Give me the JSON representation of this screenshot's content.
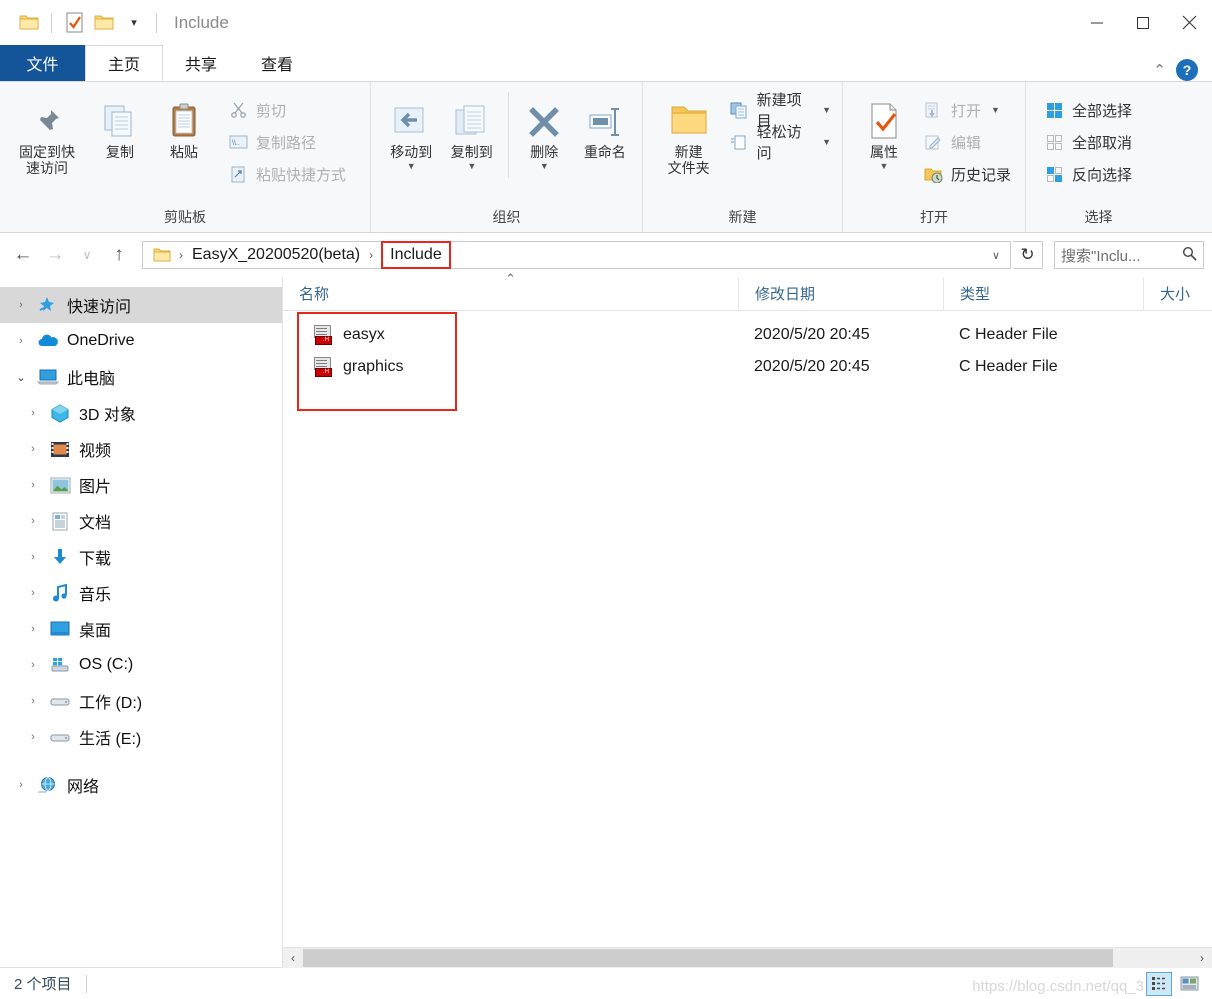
{
  "window": {
    "title": "Include",
    "minimize_label": "─",
    "maximize_label": "□",
    "close_label": "✕"
  },
  "quick_access": {
    "folder_icon": "folder-icon",
    "properties_icon": "properties-checkmark-icon",
    "new_folder_icon": "new-folder-icon",
    "customize_label": "▾"
  },
  "tabs": [
    {
      "label": "文件",
      "type": "file"
    },
    {
      "label": "主页",
      "type": "active"
    },
    {
      "label": "共享",
      "type": "normal"
    },
    {
      "label": "查看",
      "type": "normal"
    }
  ],
  "ribbon": {
    "collapse_label": "⌃",
    "help_label": "?",
    "groups": [
      {
        "name": "clipboard",
        "label": "剪贴板",
        "big_buttons": [
          {
            "name": "pin-to-quick-access",
            "line1": "固定到快",
            "line2": "速访问",
            "icon": "pin-icon"
          },
          {
            "name": "copy",
            "line1": "复制",
            "line2": "",
            "icon": "copy-icon"
          },
          {
            "name": "paste",
            "line1": "粘贴",
            "line2": "",
            "icon": "paste-clipboard-icon"
          }
        ],
        "small_buttons": [
          {
            "name": "cut",
            "label": "剪切",
            "icon": "scissors-icon"
          },
          {
            "name": "copy-path",
            "label": "复制路径",
            "icon": "copy-path-icon"
          },
          {
            "name": "paste-shortcut",
            "label": "粘贴快捷方式",
            "icon": "paste-shortcut-icon"
          }
        ]
      },
      {
        "name": "organize",
        "label": "组织",
        "big_buttons": [
          {
            "name": "move-to",
            "line1": "移动到",
            "line2": "",
            "icon": "move-to-icon",
            "caret": true
          },
          {
            "name": "copy-to",
            "line1": "复制到",
            "line2": "",
            "icon": "copy-to-icon",
            "caret": true
          },
          {
            "name": "delete",
            "line1": "删除",
            "line2": "",
            "icon": "delete-x-icon",
            "caret": true
          },
          {
            "name": "rename",
            "line1": "重命名",
            "line2": "",
            "icon": "rename-icon"
          }
        ]
      },
      {
        "name": "new",
        "label": "新建",
        "big_buttons": [
          {
            "name": "new-folder",
            "line1": "新建",
            "line2": "文件夹",
            "icon": "new-folder-icon"
          }
        ],
        "small_buttons": [
          {
            "name": "new-item",
            "label": "新建项目",
            "icon": "new-item-icon",
            "caret": true
          },
          {
            "name": "easy-access",
            "label": "轻松访问",
            "icon": "easy-access-icon",
            "caret": true
          }
        ]
      },
      {
        "name": "open",
        "label": "打开",
        "big_buttons": [
          {
            "name": "properties",
            "line1": "属性",
            "line2": "",
            "icon": "properties-checkmark-icon",
            "caret": true
          }
        ],
        "small_buttons": [
          {
            "name": "open",
            "label": "打开",
            "icon": "open-icon",
            "caret": true
          },
          {
            "name": "edit",
            "label": "编辑",
            "icon": "edit-pencil-icon"
          },
          {
            "name": "history",
            "label": "历史记录",
            "icon": "history-icon"
          }
        ]
      },
      {
        "name": "select",
        "label": "选择",
        "small_buttons": [
          {
            "name": "select-all",
            "label": "全部选择",
            "icon": "select-all-icon"
          },
          {
            "name": "select-none",
            "label": "全部取消",
            "icon": "select-none-icon"
          },
          {
            "name": "invert-selection",
            "label": "反向选择",
            "icon": "invert-selection-icon"
          }
        ]
      }
    ]
  },
  "address": {
    "back_label": "←",
    "forward_label": "→",
    "recent_label": "∨",
    "up_label": "↑",
    "folder_icon": "folder-icon",
    "crumbs": [
      {
        "label": "EasyX_20200520(beta)",
        "highlighted": false
      },
      {
        "label": "Include",
        "highlighted": true
      }
    ],
    "separator": "›",
    "dropdown_label": "∨",
    "refresh_label": "↻"
  },
  "search": {
    "text": "搜索\"Inclu...",
    "icon": "search-icon"
  },
  "nav_pane": {
    "items": [
      {
        "label": "快速访问",
        "icon": "quick-access-star-icon",
        "level": 0,
        "expanded": false,
        "selected": true
      },
      {
        "label": "OneDrive",
        "icon": "onedrive-cloud-icon",
        "level": 0,
        "expanded": false,
        "selected": false
      },
      {
        "label": "此电脑",
        "icon": "this-pc-icon",
        "level": 0,
        "expanded": true,
        "selected": false
      },
      {
        "label": "3D 对象",
        "icon": "3d-objects-icon",
        "level": 1,
        "expanded": false,
        "selected": false
      },
      {
        "label": "视频",
        "icon": "videos-icon",
        "level": 1,
        "expanded": false,
        "selected": false
      },
      {
        "label": "图片",
        "icon": "pictures-icon",
        "level": 1,
        "expanded": false,
        "selected": false
      },
      {
        "label": "文档",
        "icon": "documents-icon",
        "level": 1,
        "expanded": false,
        "selected": false
      },
      {
        "label": "下载",
        "icon": "downloads-icon",
        "level": 1,
        "expanded": false,
        "selected": false
      },
      {
        "label": "音乐",
        "icon": "music-icon",
        "level": 1,
        "expanded": false,
        "selected": false
      },
      {
        "label": "桌面",
        "icon": "desktop-icon",
        "level": 1,
        "expanded": false,
        "selected": false
      },
      {
        "label": "OS (C:)",
        "icon": "os-drive-icon",
        "level": 1,
        "expanded": false,
        "selected": false
      },
      {
        "label": "工作 (D:)",
        "icon": "drive-icon",
        "level": 1,
        "expanded": false,
        "selected": false
      },
      {
        "label": "生活 (E:)",
        "icon": "drive-icon",
        "level": 1,
        "expanded": false,
        "selected": false
      },
      {
        "label": "网络",
        "icon": "network-icon",
        "level": 0,
        "expanded": false,
        "selected": false
      }
    ],
    "collapsed_chevron": "›",
    "expanded_chevron": "⌄"
  },
  "file_list": {
    "columns": [
      {
        "key": "name",
        "label": "名称"
      },
      {
        "key": "date",
        "label": "修改日期"
      },
      {
        "key": "type",
        "label": "类型"
      },
      {
        "key": "size",
        "label": "大小"
      }
    ],
    "sort_indicator": "⌃",
    "rows": [
      {
        "name": "easyx",
        "date": "2020/5/20 20:45",
        "type": "C Header File",
        "size": "",
        "icon": "c-header-file-icon"
      },
      {
        "name": "graphics",
        "date": "2020/5/20 20:45",
        "type": "C Header File",
        "size": "",
        "icon": "c-header-file-icon"
      }
    ]
  },
  "scrollbar": {
    "left_arrow": "‹",
    "right_arrow": "›"
  },
  "status_bar": {
    "item_count": "2 个项目",
    "watermark": "https://blog.csdn.net/qq_3",
    "views": [
      {
        "name": "details-view-button",
        "icon": "details-view-icon",
        "selected": true
      },
      {
        "name": "large-icons-view-button",
        "icon": "large-icons-view-icon",
        "selected": false
      }
    ]
  },
  "colors": {
    "accent": "#14559a",
    "highlight_box": "#e8261c",
    "selection": "#d8d8d8"
  }
}
